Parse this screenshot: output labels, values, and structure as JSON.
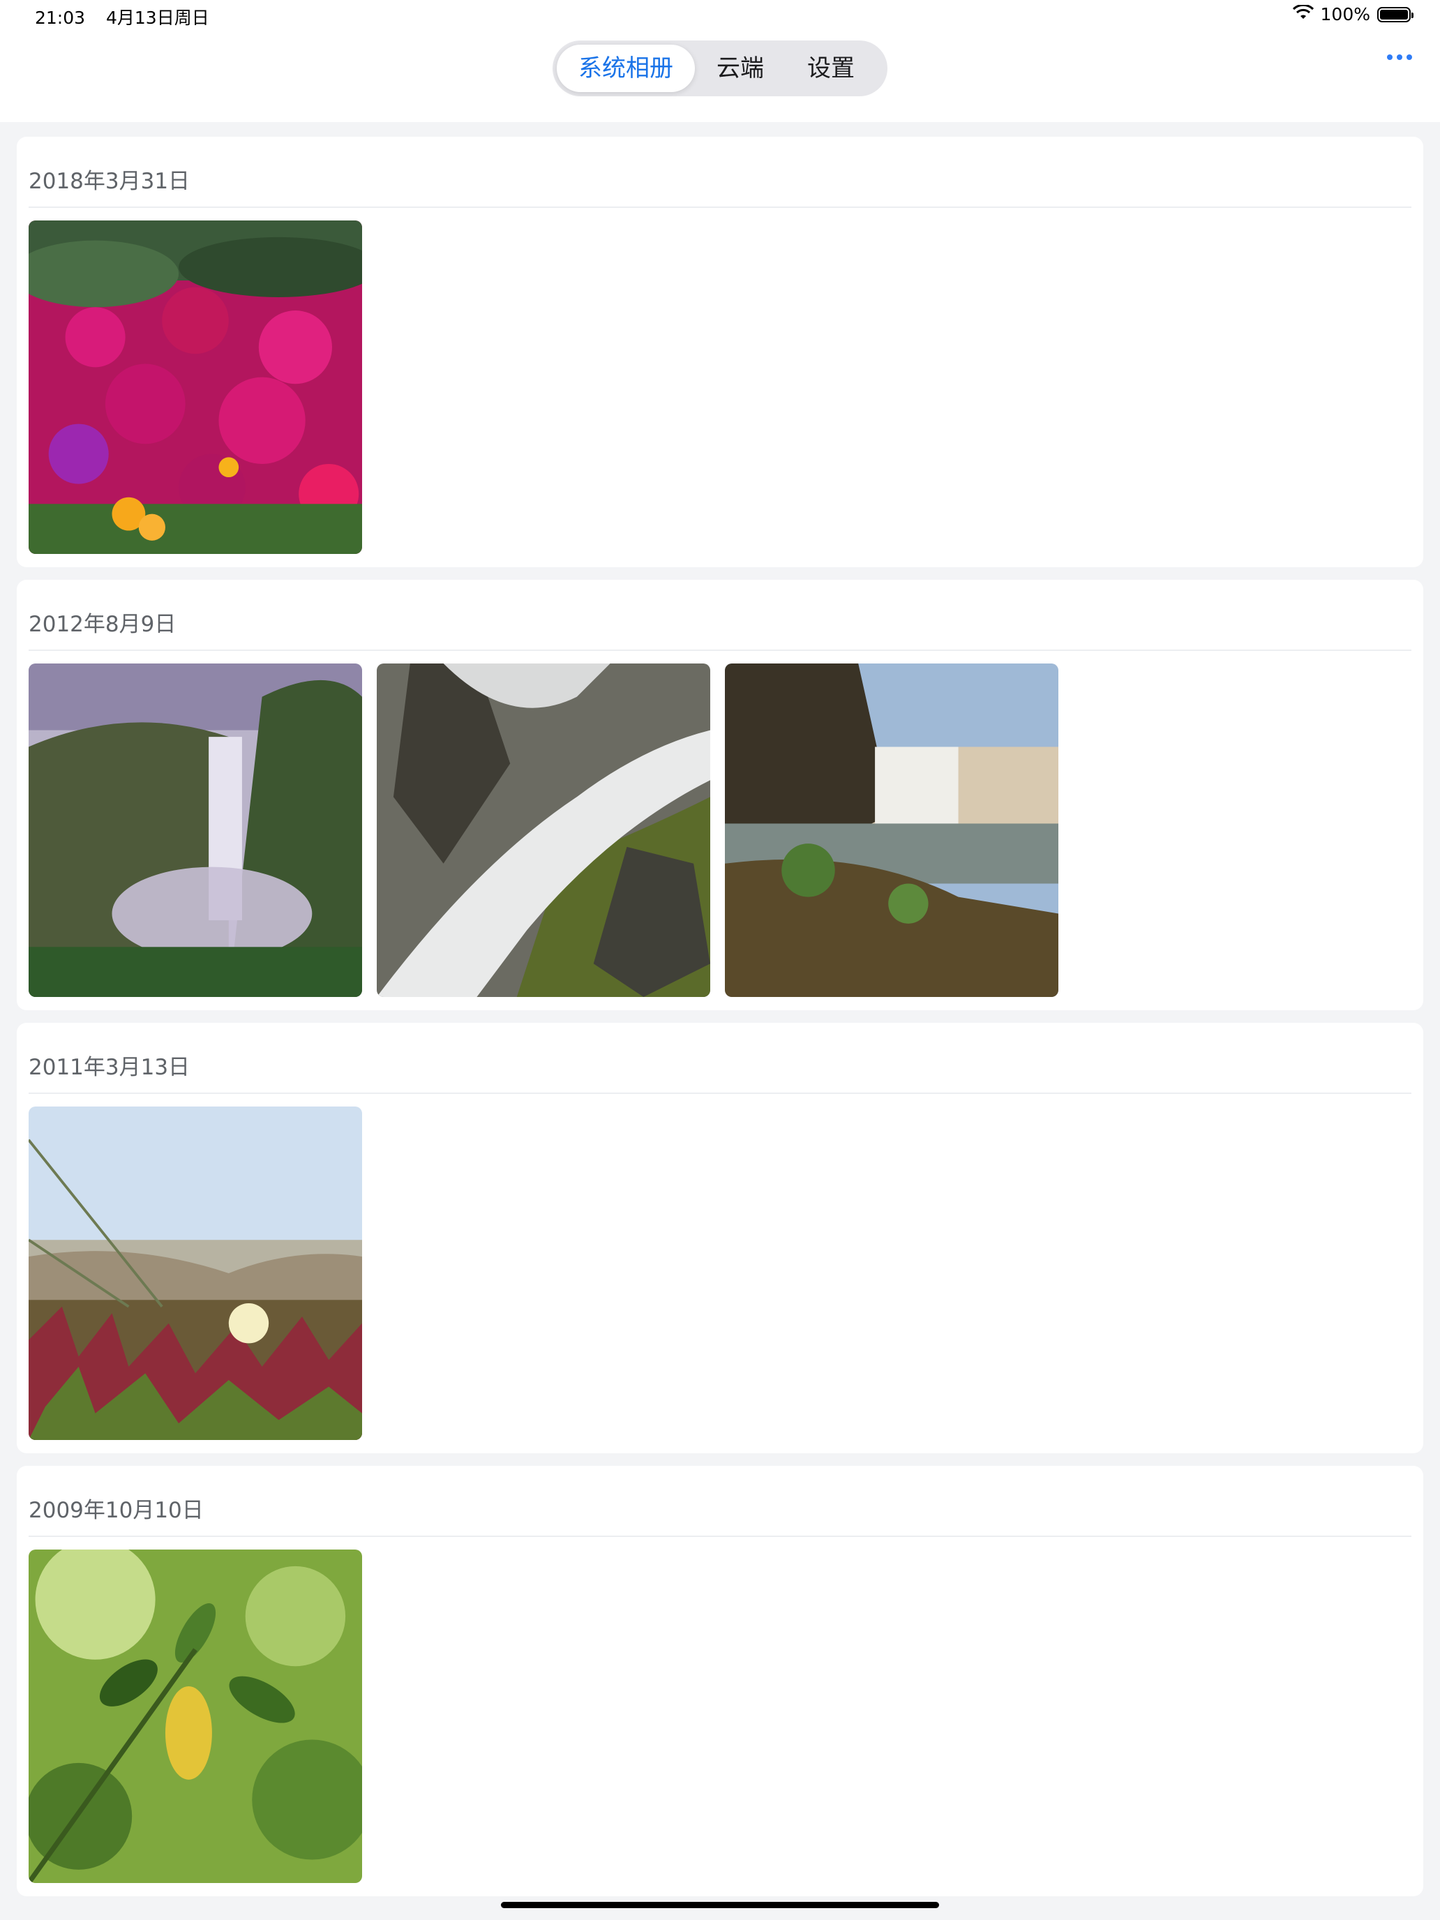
{
  "status": {
    "time": "21:03",
    "date": "4月13日周日",
    "battery": "100%"
  },
  "tabs": [
    {
      "label": "系统相册",
      "active": true
    },
    {
      "label": "云端",
      "active": false
    },
    {
      "label": "设置",
      "active": false
    }
  ],
  "sections": [
    {
      "date": "2018年3月31日",
      "photos": [
        "flowers"
      ]
    },
    {
      "date": "2012年8月9日",
      "photos": [
        "waterfall-mist",
        "waterfall-rocks",
        "waterfall-cliff"
      ]
    },
    {
      "date": "2011年3月13日",
      "photos": [
        "beach-flower"
      ]
    },
    {
      "date": "2009年10月10日",
      "photos": [
        "leaves"
      ]
    }
  ],
  "colors": {
    "accent": "#1a73e8",
    "background": "#f3f4f6",
    "card": "#ffffff"
  },
  "icons": {
    "more": "more-horizontal-icon",
    "wifi": "wifi-icon",
    "battery": "battery-icon"
  }
}
